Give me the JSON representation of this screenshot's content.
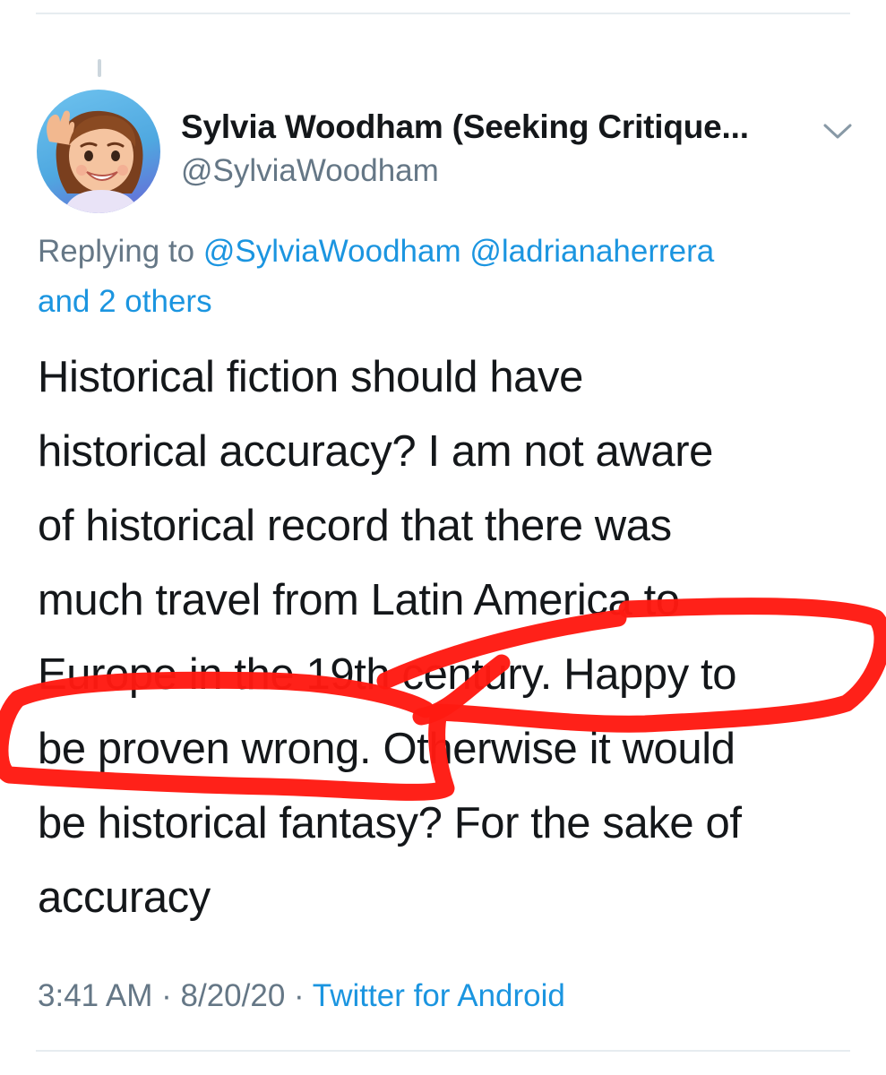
{
  "author": {
    "display_name": "Sylvia Woodham (Seeking Critique...",
    "handle": "@SylviaWoodham",
    "avatar_icon": "memoji-avatar-icon"
  },
  "more_menu_icon": "chevron-down-icon",
  "reply_context": {
    "prefix": "Replying to",
    "mention_1": "@SylviaWoodham",
    "mention_2": "@ladrianaherrera",
    "others": "and 2 others"
  },
  "tweet": {
    "lines": [
      "Historical fiction should have",
      "historical accuracy? I am not aware",
      "of historical record that there was",
      "much travel from Latin America to",
      "Europe in the 19th century. Happy to",
      "be proven wrong. Otherwise it would",
      "be historical fantasy? For the sake of",
      "accuracy"
    ]
  },
  "meta": {
    "time": "3:41 AM",
    "separator_1": " · ",
    "date": "8/20/20",
    "separator_2": " · ",
    "source": "Twitter for Android"
  },
  "colors": {
    "link_blue": "#1b95e0",
    "secondary_gray": "#657786",
    "annotation_red": "#ff1a12"
  }
}
